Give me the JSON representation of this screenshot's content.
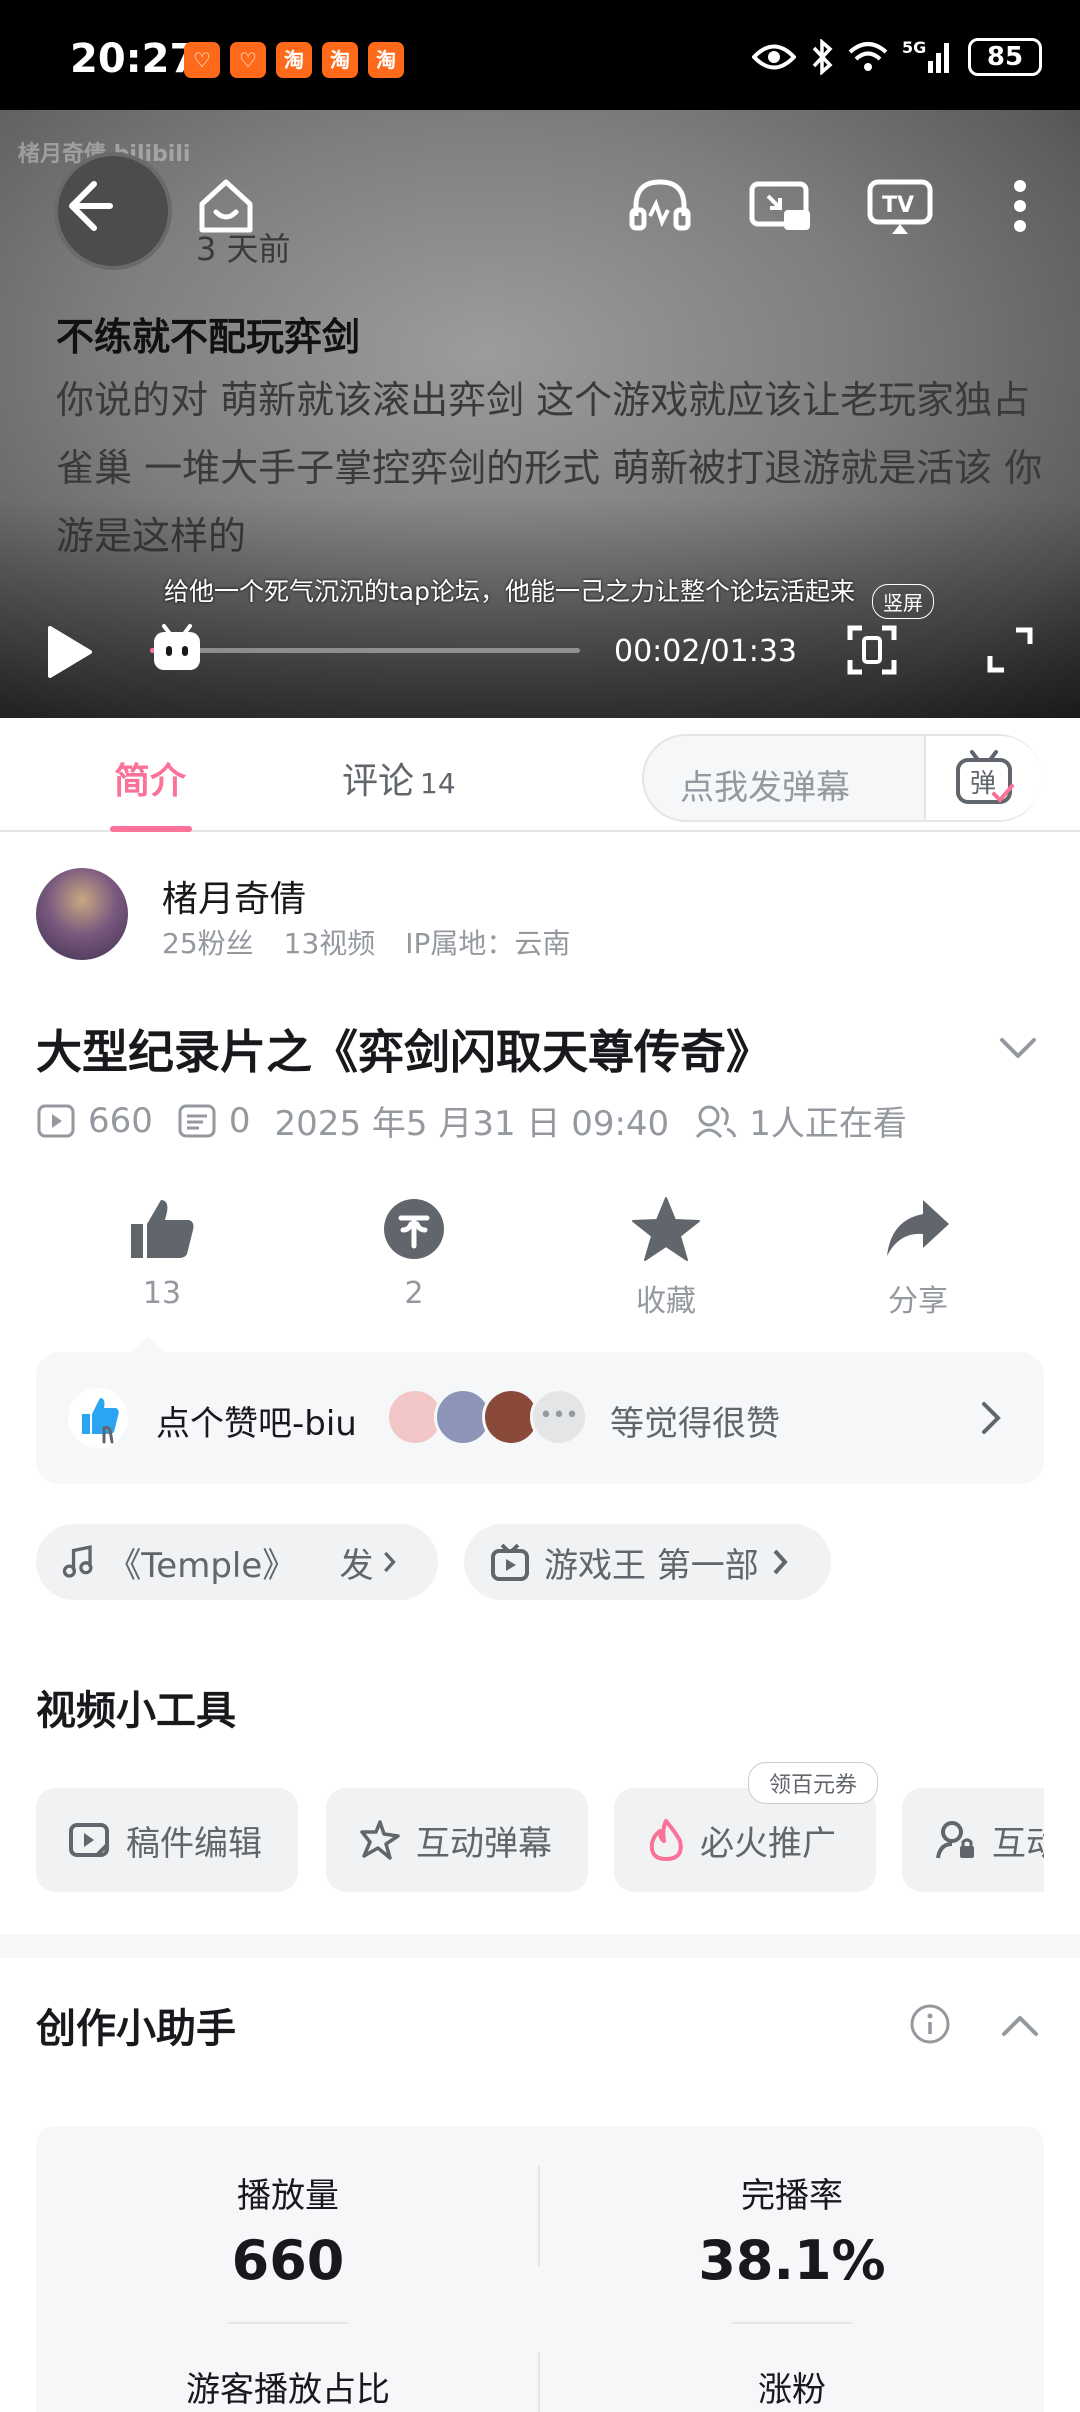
{
  "status_bar": {
    "time": "20:27",
    "battery": "85",
    "app_icons": [
      "pdd-icon",
      "pdd-icon",
      "taobao-icon",
      "taobao-icon",
      "taobao-icon"
    ]
  },
  "video": {
    "watermark": "楮月奇倩 bilibili",
    "post_ago": "3 天前",
    "overlay_title": "不练就不配玩弈剑",
    "overlay_text": "你说的对 萌新就该滚出弈剑 这个游戏就应该让老玩家独占雀巢 一堆大手子掌控弈剑的形式 萌新被打退游就是活该 你游是这样的",
    "subtitle": "给他一个死气沉沉的tap论坛，他能一己之力让整个论坛活起来",
    "time_display": "00:02/01:33",
    "vertical_tag": "竖屏",
    "progress_fraction": 0.0215,
    "accent_color": "#fb7299"
  },
  "tabs": {
    "intro": "简介",
    "comments": "评论",
    "comments_count": "14",
    "danmaku_placeholder": "点我发弹幕",
    "danmaku_button": "弹"
  },
  "uploader": {
    "name": "楮月奇倩",
    "fans": "25粉丝",
    "videos": "13视频",
    "ip": "IP属地：云南"
  },
  "video_info": {
    "title": "大型纪录片之《弈剑闪取天尊传奇》",
    "plays": "660",
    "danmaku": "0",
    "date": "2025 年5 月31 日 09:40",
    "watching": "1人正在看"
  },
  "actions": [
    {
      "label": "13",
      "icon": "thumbs-up-icon"
    },
    {
      "label": "2",
      "icon": "coin-icon"
    },
    {
      "label": "收藏",
      "icon": "star-icon"
    },
    {
      "label": "分享",
      "icon": "share-icon"
    }
  ],
  "like_card": {
    "text": "点个赞吧-biu",
    "tail": "等觉得很赞"
  },
  "chips": {
    "music": "《Temple》    发",
    "collection": "游戏王 第一部"
  },
  "tools": {
    "title": "视频小工具",
    "badge": "领百元券",
    "items": [
      "稿件编辑",
      "互动弹幕",
      "必火推广",
      "互动"
    ]
  },
  "assistant": {
    "title": "创作小助手",
    "metrics": [
      {
        "label": "播放量",
        "value": "660"
      },
      {
        "label": "完播率",
        "value": "38.1%"
      },
      {
        "label": "游客播放占比",
        "value": ""
      },
      {
        "label": "涨粉",
        "value": ""
      }
    ]
  }
}
